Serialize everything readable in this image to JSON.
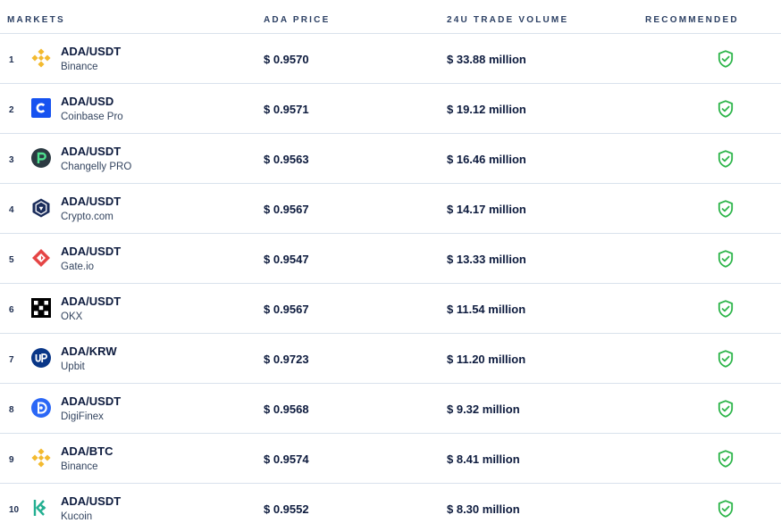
{
  "header": {
    "markets": "MARKETS",
    "price": "ADA PRICE",
    "volume": "24U TRADE VOLUME",
    "recommended": "RECOMMENDED"
  },
  "colors": {
    "recommended_green": "#2db54a",
    "binance": "#f3ba2f",
    "coinbase": "#1652f0",
    "changelly": "#2b3a42",
    "crypto_com": "#1a2c5b",
    "gate": "#e54545",
    "okx": "#000000",
    "upbit": "#093687",
    "digifinex": "#2b67f6",
    "kucoin": "#23af91"
  },
  "rows": [
    {
      "rank": "1",
      "pair": "ADA/USDT",
      "exchange": "Binance",
      "price": "$ 0.9570",
      "volume": "$ 33.88 million",
      "icon": "binance-logo-icon",
      "recommended": true
    },
    {
      "rank": "2",
      "pair": "ADA/USD",
      "exchange": "Coinbase Pro",
      "price": "$ 0.9571",
      "volume": "$ 19.12 million",
      "icon": "coinbase-logo-icon",
      "recommended": true
    },
    {
      "rank": "3",
      "pair": "ADA/USDT",
      "exchange": "Changelly PRO",
      "price": "$ 0.9563",
      "volume": "$ 16.46 million",
      "icon": "changelly-logo-icon",
      "recommended": true
    },
    {
      "rank": "4",
      "pair": "ADA/USDT",
      "exchange": "Crypto.com",
      "price": "$ 0.9567",
      "volume": "$ 14.17 million",
      "icon": "crypto-com-logo-icon",
      "recommended": true
    },
    {
      "rank": "5",
      "pair": "ADA/USDT",
      "exchange": "Gate.io",
      "price": "$ 0.9547",
      "volume": "$ 13.33 million",
      "icon": "gate-io-logo-icon",
      "recommended": true
    },
    {
      "rank": "6",
      "pair": "ADA/USDT",
      "exchange": "OKX",
      "price": "$ 0.9567",
      "volume": "$ 11.54 million",
      "icon": "okx-logo-icon",
      "recommended": true
    },
    {
      "rank": "7",
      "pair": "ADA/KRW",
      "exchange": "Upbit",
      "price": "$ 0.9723",
      "volume": "$ 11.20 million",
      "icon": "upbit-logo-icon",
      "recommended": true
    },
    {
      "rank": "8",
      "pair": "ADA/USDT",
      "exchange": "DigiFinex",
      "price": "$ 0.9568",
      "volume": "$ 9.32 million",
      "icon": "digifinex-logo-icon",
      "recommended": true
    },
    {
      "rank": "9",
      "pair": "ADA/BTC",
      "exchange": "Binance",
      "price": "$ 0.9574",
      "volume": "$ 8.41 million",
      "icon": "binance-logo-icon",
      "recommended": true
    },
    {
      "rank": "10",
      "pair": "ADA/USDT",
      "exchange": "Kucoin",
      "price": "$ 0.9552",
      "volume": "$ 8.30 million",
      "icon": "kucoin-logo-icon",
      "recommended": true
    }
  ]
}
